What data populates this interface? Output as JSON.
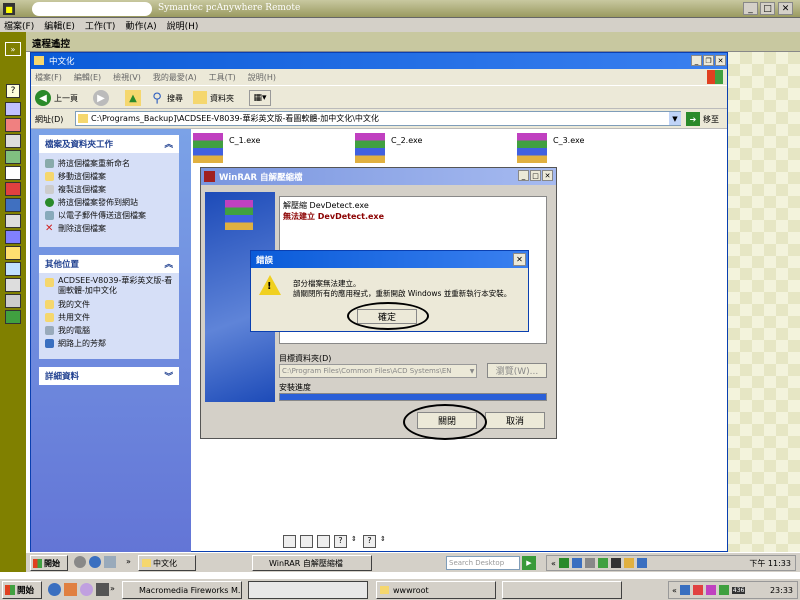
{
  "pca_window": {
    "title": "Symantec pcAnywhere Remote",
    "menu": [
      "檔案(F)",
      "編輯(E)",
      "工作(T)",
      "動作(A)",
      "說明(H)"
    ],
    "session_title": "遠程遙控"
  },
  "explorer": {
    "title": "中文化",
    "menu": [
      "檔案(F)",
      "編輯(E)",
      "檢視(V)",
      "我的最愛(A)",
      "工具(T)",
      "說明(H)"
    ],
    "back_label": "上一頁",
    "search_label": "搜尋",
    "folders_label": "資料夾",
    "address_label": "網址(D)",
    "address_value": "C:\\Programs_Backup]\\ACDSEE-V8039-華彩英文版-看圖軟體-加中文化\\中文化",
    "go_label": "移至",
    "tasks_title": "檔案及資料夾工作",
    "tasks": [
      "將這個檔案重新命名",
      "移動這個檔案",
      "複製這個檔案",
      "將這個檔案發佈到網站",
      "以電子郵件傳送這個檔案",
      "刪除這個檔案"
    ],
    "places_title": "其他位置",
    "places": [
      "ACDSEE-V8039-華彩英文版-看圖軟體-加中文化",
      "我的文件",
      "共用文件",
      "我的電腦",
      "網路上的芳鄰"
    ],
    "details_title": "詳細資料",
    "files": [
      "C_1.exe",
      "C_2.exe",
      "C_3.exe"
    ]
  },
  "winrar": {
    "title": "WinRAR 自解壓縮檔",
    "log_line1": "解壓縮 DevDetect.exe",
    "log_line2": "無法建立 DevDetect.exe",
    "dest_label": "目標資料夾(D)",
    "dest_value": "C:\\Program Files\\Common Files\\ACD Systems\\EN",
    "browse_label": "瀏覽(W)...",
    "progress_label": "安裝進度",
    "progress": 1.0,
    "close_label": "關閉",
    "cancel_label": "取消"
  },
  "error_dialog": {
    "title": "錯誤",
    "line1": "部分檔案無法建立。",
    "line2": "請關閉所有的應用程式，重新開啟 Windows 並重新執行本安裝。",
    "ok_label": "確定"
  },
  "remote_taskbar": {
    "start_label": "開始",
    "task_label": "中文化",
    "task2_label": "WinRAR 自解壓縮檔",
    "search_placeholder": "Search Desktop",
    "clock": "下午 11:33"
  },
  "local_taskbar": {
    "start_label": "開始",
    "tasks": [
      "Macromedia Fireworks M...",
      "",
      "wwwroot",
      ""
    ],
    "clock": "23:33",
    "badge": "436"
  },
  "colors": {
    "xp_blue": "#0a5bd8",
    "title_olive": "#7f7f00",
    "rar_red": "#8b0000"
  }
}
